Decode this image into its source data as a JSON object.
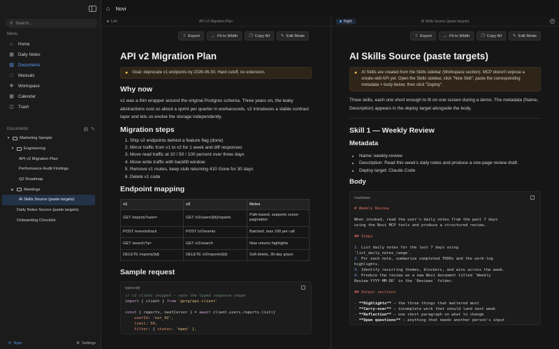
{
  "app": {
    "title": "Novi"
  },
  "sidebar": {
    "search_placeholder": "Search...",
    "menu_label": "Menu",
    "menu": [
      {
        "label": "Home",
        "icon": "home-icon"
      },
      {
        "label": "Daily Notes",
        "icon": "calendar-icon"
      },
      {
        "label": "Documents",
        "icon": "document-icon"
      },
      {
        "label": "Manuals",
        "icon": "book-icon"
      },
      {
        "label": "Workspace",
        "icon": "workspace-icon"
      },
      {
        "label": "Calendar",
        "icon": "calendar-icon"
      },
      {
        "label": "Trash",
        "icon": "trash-icon"
      }
    ],
    "documents_label": "Documents",
    "tree": [
      {
        "label": "Marketing Sample"
      },
      {
        "label": "Engineering"
      },
      {
        "label": "API v2 Migration Plan"
      },
      {
        "label": "Performance Audit Findings"
      },
      {
        "label": "Q2 Roadmap"
      },
      {
        "label": "Meetings"
      },
      {
        "label": "AI Skills Source (paste targets)"
      },
      {
        "label": "Daily Notes Source (paste targets)"
      },
      {
        "label": "Onboarding Checklist"
      }
    ],
    "sync_label": "Sync",
    "settings_label": "Settings"
  },
  "toolbar": {
    "export": "Export",
    "fit": "Fit to Width",
    "copy": "Copy All",
    "edit": "Edit Mode"
  },
  "left_pane": {
    "side": "Left",
    "tab_title": "API v2 Migration Plan",
    "title": "API v2 Migration Plan",
    "callout": "Goal: deprecate v1 endpoints by 2026-06-30. Hard cutoff, no extension.",
    "why_heading": "Why now",
    "why_body": "v1 was a thin wrapper around the original Postgres schema. Three years on, the leaky abstractions cost us about a sprint per quarter in workarounds. v2 introduces a stable contract layer and lets us evolve the storage independently.",
    "steps_heading": "Migration steps",
    "steps": [
      "Ship v2 endpoints behind a feature flag (done)",
      "Mirror traffic from v1 to v2 for 1 week and diff responses",
      "Move read traffic at 10 / 50 / 100 percent over three days",
      "Move write traffic with backfill window",
      "Remove v1 routes, keep stub returning 410 Gone for 30 days",
      "Delete v1 code"
    ],
    "mapping_heading": "Endpoint mapping",
    "table_headers": [
      "v1",
      "v2",
      "Notes"
    ],
    "table_rows": [
      [
        "GET /reports?user=",
        "GET /v2/users/{id}/reports",
        "Path-based, supports cursor pagination"
      ],
      [
        "POST /events/track",
        "POST /v2/events",
        "Batched, max 100 per call"
      ],
      [
        "GET /search?q=",
        "GET /v2/search",
        "Now returns highlights"
      ],
      [
        "DELETE /reports/{id}",
        "DELETE /v2/reports/{id}",
        "Soft delete, 30-day grace"
      ]
    ],
    "sample_heading": "Sample request",
    "code_lang": "typescript",
    "code": {
      "l1": "// v2 client snippet — note the typed response shape",
      "l2_kw": "import",
      "l2_mid": " { client } ",
      "l2_from": "from",
      "l2_str": " '@org/api-client'",
      "l3_kw": "const",
      "l3_mid": " { reports, nextCursor } = ",
      "l3_kw2": "await",
      "l3_rest": " client.users.reports.list({",
      "l4_prop": "userId",
      "l4_val": " 'usr_42',",
      "l5_prop": "limit",
      "l5_val": " 50,",
      "l6_prop": "filter",
      "l6_mid": " { ",
      "l6_prop2": "status",
      "l6_val": " 'open' },"
    }
  },
  "right_pane": {
    "side": "Right",
    "tab_title": "AI Skills Source (paste targets)",
    "title": "AI Skills Source (paste targets)",
    "callout": "AI Skills are created from the Skills sidebar (Workspace section). MCP doesn't expose a create-skill API yet. Open the Skills sidebar, click \"New Skill\", paste the corresponding metadata + body below, then click \"Deploy\".",
    "intro": "Three skills, each one short enough to fit on one screen during a demo. The metadata (Name, Description) appears in the deploy target alongside the body.",
    "skill_heading": "Skill 1 — Weekly Review",
    "metadata_heading": "Metadata",
    "metadata": [
      "Name: weekly-review",
      "Description: Read this week's daily notes and produce a one-page review draft.",
      "Deploy target: Claude Code"
    ],
    "body_heading": "Body",
    "code_lang": "markdown",
    "md": {
      "h1": "# Weekly Review",
      "p1a": "When invoked, read the user's daily notes from the past 7 days",
      "p1b": "using the Novi MCP tools and produce a structured review.",
      "h2": "## Steps",
      "s1a": "List daily notes for the last 7 days using",
      "s1b": "`list_daily_notes_range`.",
      "s2a": "For each note, summarize completed TODOs and the work-log",
      "s2b": "highlights.",
      "s3": "Identify recurring themes, blockers, and wins across the week.",
      "s4a": "Produce the review as a new Novi document titled `Weekly",
      "s4b": "Review YYYY-MM-DD` in the `Reviews` folder.",
      "h3": "## Output sections",
      "o1b": "**Highlights**",
      "o1r": " — the three things that mattered most",
      "o2b": "**Carry-over**",
      "o2r": " — incomplete work that should land next week",
      "o3b": "**Reflection**",
      "o3r": " — one short paragraph on what to change",
      "o4b": "**Open questions**",
      "o4r": " — anything that needs another person's input",
      "n1": "1.",
      "n2": "2.",
      "n3": "3.",
      "n4": "4.",
      "dash": "-"
    }
  }
}
